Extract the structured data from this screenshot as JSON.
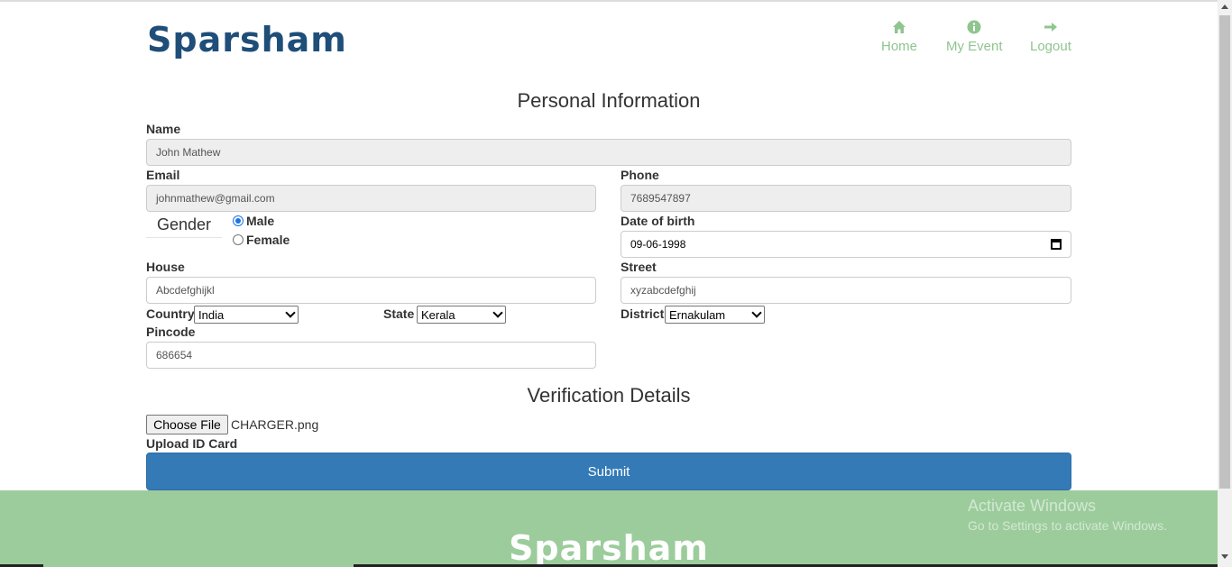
{
  "brand": {
    "name": "Sparsham"
  },
  "nav": [
    {
      "label": "Home",
      "icon": "home-icon"
    },
    {
      "label": "My Event",
      "icon": "info-icon"
    },
    {
      "label": "Logout",
      "icon": "arrow-right-icon"
    }
  ],
  "personal": {
    "heading": "Personal Information",
    "name_label": "Name",
    "name_value": "John Mathew",
    "email_label": "Email",
    "email_value": "johnmathew@gmail.com",
    "phone_label": "Phone",
    "phone_value": "7689547897",
    "gender_label": "Gender",
    "gender_options": [
      "Male",
      "Female"
    ],
    "gender_selected": "Male",
    "dob_label": "Date of birth",
    "dob_value": "09-06-1998",
    "house_label": "House",
    "house_value": "Abcdefghijkl",
    "street_label": "Street",
    "street_value": "xyzabcdefghij",
    "country_label": "Country",
    "country_value": "India",
    "state_label": "State",
    "state_value": "Kerala",
    "district_label": "District",
    "district_value": "Ernakulam",
    "pincode_label": "Pincode",
    "pincode_value": "686654"
  },
  "verification": {
    "heading": "Verification Details",
    "file_button": "Choose File",
    "file_name": "CHARGER.png",
    "upload_label": "Upload ID Card",
    "submit_label": "Submit"
  },
  "footer": {
    "brand": "Sparsham"
  },
  "watermark": {
    "line1": "Activate Windows",
    "line2": "Go to Settings to activate Windows."
  },
  "colors": {
    "brand": "#1f4e79",
    "nav": "#8fc58f",
    "primary_button": "#337ab7",
    "footer": "#9ccc9c"
  }
}
